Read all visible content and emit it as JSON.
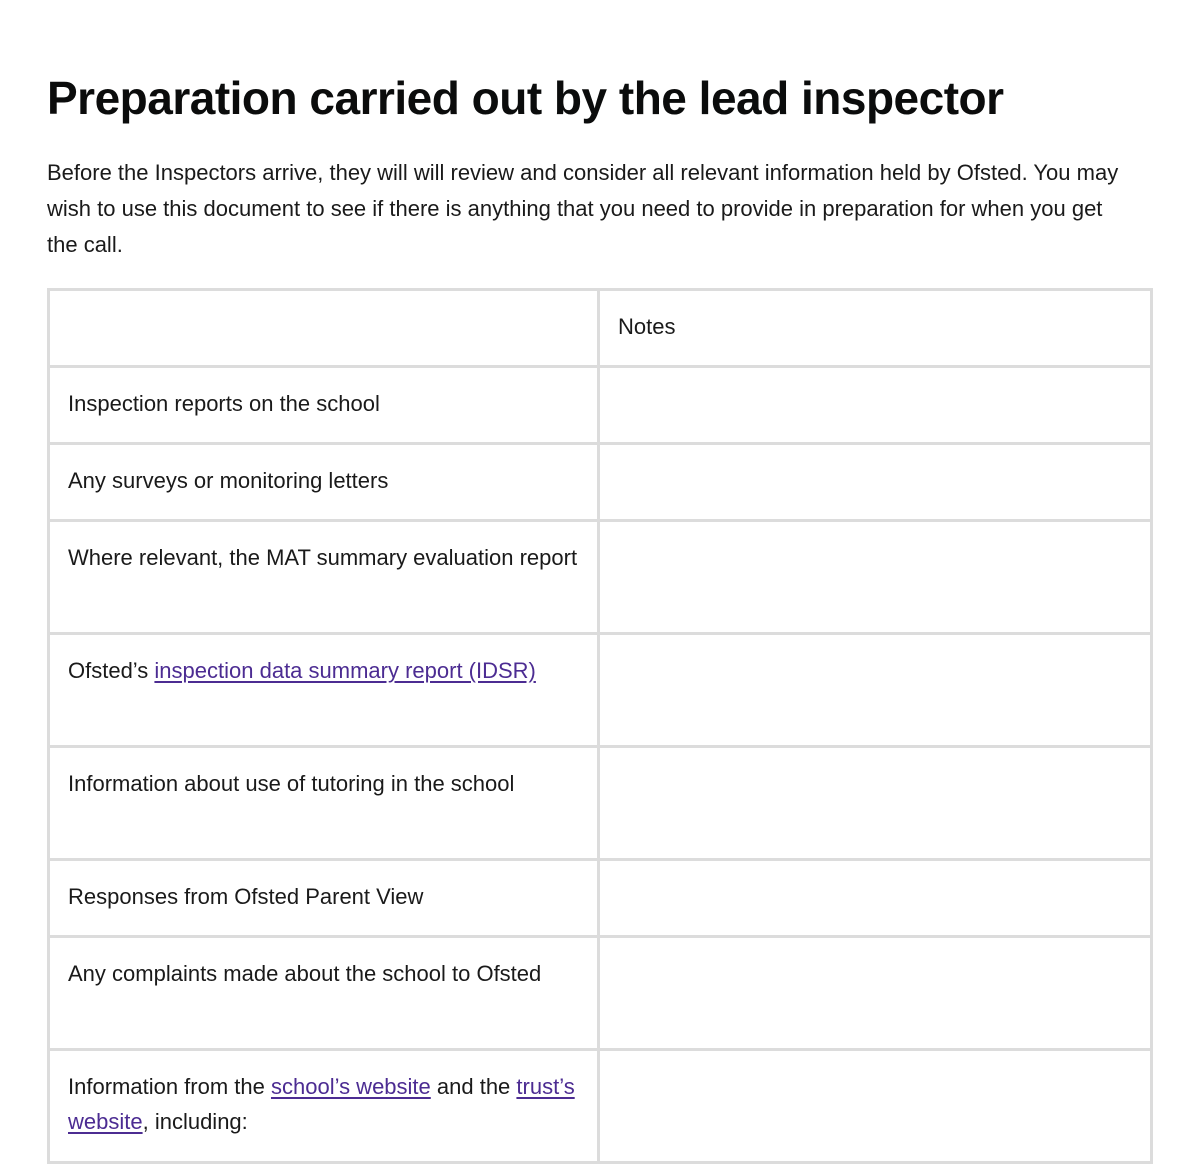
{
  "page": {
    "title": "Preparation carried out by the lead inspector",
    "intro": "Before the Inspectors arrive, they will will review and consider all relevant information held by Ofsted. You may wish to use this document to see if there is anything that you need to provide in preparation for when you get the call."
  },
  "table": {
    "headers": [
      "",
      "Notes"
    ],
    "rows": [
      {
        "item": "Inspection reports on the school",
        "notes": ""
      },
      {
        "item": "Any surveys or monitoring letters",
        "notes": ""
      },
      {
        "item": "Where relevant, the MAT summary evaluation report",
        "notes": ""
      },
      {
        "item_prefix": "Ofsted’s ",
        "item_link": "inspection data summary report (IDSR)",
        "notes": ""
      },
      {
        "item": "Information about use of tutoring in the school",
        "notes": ""
      },
      {
        "item": "Responses from Ofsted Parent View",
        "notes": ""
      },
      {
        "item": "Any complaints made about the school to Ofsted",
        "notes": ""
      },
      {
        "item_prefix": "Information from the ",
        "item_link1": "school’s website",
        "item_mid": " and the ",
        "item_link2": "trust’s website",
        "item_suffix": ", including:",
        "notes": ""
      }
    ]
  },
  "colors": {
    "link": "#4c2c92",
    "border": "#dcdcdc",
    "text": "#0b0c0c"
  }
}
